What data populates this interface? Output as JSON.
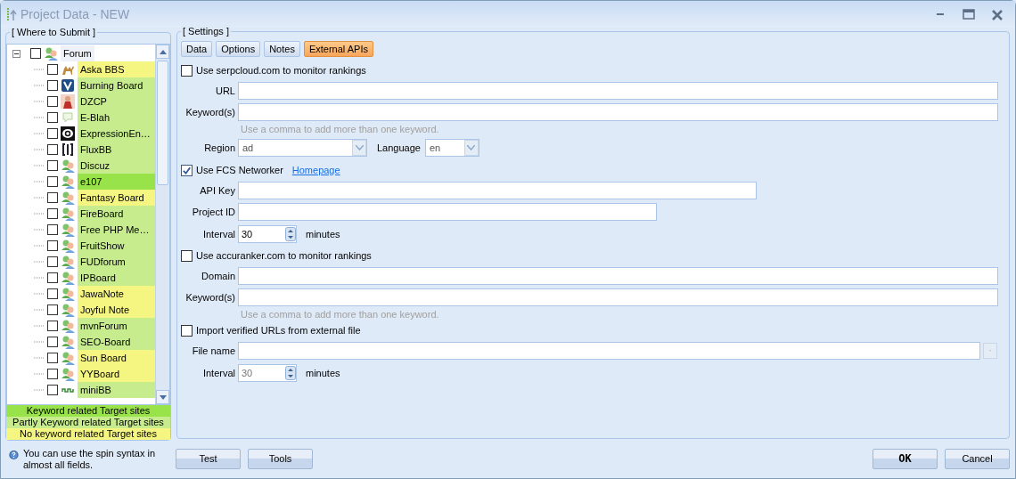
{
  "window": {
    "title": "Project Data - NEW"
  },
  "submit_panel": {
    "title": "[ Where to Submit ]",
    "tree": {
      "label": "Forum",
      "checked": false,
      "expanded": true,
      "children": [
        {
          "label": "Aska BBS",
          "checked": false,
          "kind": "camel",
          "color": "#f5f582"
        },
        {
          "label": "Burning Board",
          "checked": false,
          "kind": "shield",
          "color": "#c6ec8e"
        },
        {
          "label": "DZCP",
          "checked": false,
          "kind": "figure",
          "color": "#c6ec8e"
        },
        {
          "label": "E-Blah",
          "checked": false,
          "kind": "speech",
          "color": "#c6ec8e"
        },
        {
          "label": "ExpressionEn…",
          "checked": false,
          "kind": "disc",
          "color": "#c6ec8e"
        },
        {
          "label": "FluxBB",
          "checked": false,
          "kind": "brackets",
          "color": "#c6ec8e"
        },
        {
          "label": "Discuz",
          "checked": false,
          "kind": "people",
          "color": "#c6ec8e"
        },
        {
          "label": "e107",
          "checked": false,
          "kind": "people",
          "color": "#99e34a"
        },
        {
          "label": "Fantasy Board",
          "checked": false,
          "kind": "people",
          "color": "#f5f582"
        },
        {
          "label": "FireBoard",
          "checked": false,
          "kind": "people",
          "color": "#c6ec8e"
        },
        {
          "label": "Free PHP Me…",
          "checked": false,
          "kind": "people",
          "color": "#c6ec8e"
        },
        {
          "label": "FruitShow",
          "checked": false,
          "kind": "people",
          "color": "#c6ec8e"
        },
        {
          "label": "FUDforum",
          "checked": false,
          "kind": "people",
          "color": "#c6ec8e"
        },
        {
          "label": "IPBoard",
          "checked": false,
          "kind": "people",
          "color": "#c6ec8e"
        },
        {
          "label": "JawaNote",
          "checked": false,
          "kind": "people",
          "color": "#f5f582"
        },
        {
          "label": "Joyful Note",
          "checked": false,
          "kind": "people",
          "color": "#f5f582"
        },
        {
          "label": "mvnForum",
          "checked": false,
          "kind": "people",
          "color": "#c6ec8e"
        },
        {
          "label": "SEO-Board",
          "checked": false,
          "kind": "people",
          "color": "#c6ec8e"
        },
        {
          "label": "Sun Board",
          "checked": false,
          "kind": "people",
          "color": "#f5f582"
        },
        {
          "label": "YYBoard",
          "checked": false,
          "kind": "people",
          "color": "#f5f582"
        },
        {
          "label": "miniBB",
          "checked": false,
          "kind": "wave",
          "color": "#c6ec8e"
        }
      ]
    },
    "legend": [
      {
        "label": "Keyword related Target sites",
        "color": "#99e34a"
      },
      {
        "label": "Partly Keyword related Target sites",
        "color": "#c6ec8e"
      },
      {
        "label": "No keyword related Target sites",
        "color": "#f5f582"
      }
    ],
    "help": "You can use the spin syntax in almost all fields."
  },
  "settings": {
    "title": "[ Settings ]",
    "tabs": [
      {
        "label": "Data",
        "selected": false
      },
      {
        "label": "Options",
        "selected": false
      },
      {
        "label": "Notes",
        "selected": false
      },
      {
        "label": "External APIs",
        "selected": true
      }
    ],
    "rows": [
      {
        "kind": "check",
        "label": "Use serpcloud.com to monitor rankings",
        "checked": false
      },
      {
        "kind": "field",
        "label": "URL"
      },
      {
        "kind": "field",
        "label": "Keyword(s)"
      },
      {
        "kind": "hint",
        "label": "Use a comma to add more than one keyword."
      },
      {
        "kind": "selects",
        "label": "Region",
        "value": "ad",
        "label_2": "Language",
        "value_2": "en"
      },
      {
        "kind": "check",
        "label": "Use FCS Networker",
        "checked": true,
        "link": "Homepage"
      },
      {
        "kind": "field",
        "label": "API Key"
      },
      {
        "kind": "field",
        "label": "Project ID"
      },
      {
        "kind": "spin",
        "label": "Interval",
        "value": "30",
        "unit": "minutes",
        "disabled": false
      },
      {
        "kind": "check",
        "label": "Use accuranker.com to monitor rankings",
        "checked": false
      },
      {
        "kind": "field",
        "label": "Domain"
      },
      {
        "kind": "field",
        "label": "Keyword(s)"
      },
      {
        "kind": "hint",
        "label": "Use a comma to add more than one keyword."
      },
      {
        "kind": "check",
        "label": "Import verified URLs from external file",
        "checked": false
      },
      {
        "kind": "file",
        "label": "File name"
      },
      {
        "kind": "spin",
        "label": "Interval",
        "value": "30",
        "unit": "minutes",
        "disabled": true
      }
    ]
  },
  "buttons_left": [
    "Test",
    "Tools"
  ],
  "buttons_right": [
    "OK",
    "Cancel"
  ]
}
